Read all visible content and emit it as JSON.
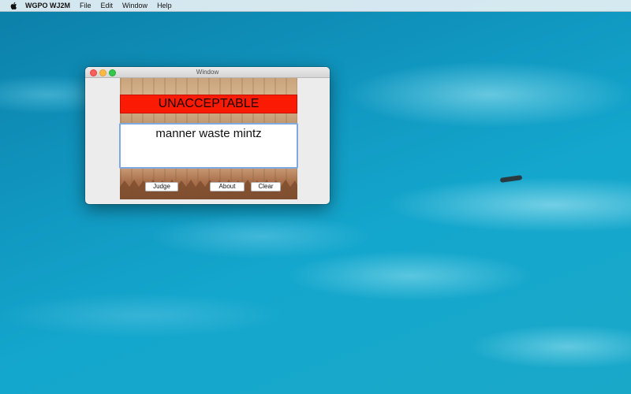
{
  "menubar": {
    "apple_icon": "apple-icon",
    "app_name": "WGPO WJ2M",
    "items": [
      "File",
      "Edit",
      "Window",
      "Help"
    ]
  },
  "window": {
    "title": "Window",
    "verdict": "UNACCEPTABLE",
    "verdict_color": "#fb1a03",
    "input_value": "manner waste mintz",
    "buttons": {
      "judge": "Judge",
      "about": "About",
      "clear": "Clear"
    }
  }
}
